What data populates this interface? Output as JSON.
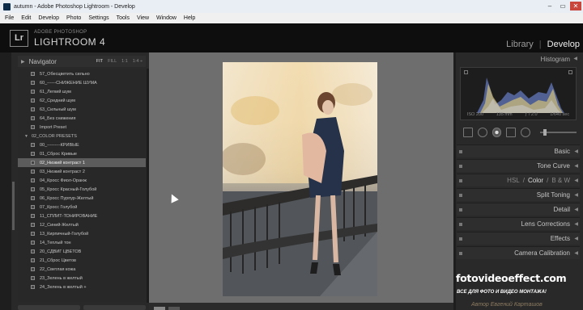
{
  "window": {
    "title": "autumn - Adobe Photoshop Lightroom - Develop",
    "controls": [
      "–",
      "▭",
      "✕"
    ]
  },
  "menu": [
    "File",
    "Edit",
    "Develop",
    "Photo",
    "Settings",
    "Tools",
    "View",
    "Window",
    "Help"
  ],
  "identity": {
    "logo": "Lr",
    "sup": "ADOBE PHOTOSHOP",
    "product": "LIGHTROOM 4",
    "modules": [
      "Library",
      "|",
      "Develop"
    ]
  },
  "navigator": {
    "label": "Navigator",
    "zoom": [
      "FIT",
      "FILL",
      "1:1",
      "1:4 ÷"
    ]
  },
  "presets": [
    {
      "label": "57_Обесцветить сильно",
      "kind": "item"
    },
    {
      "label": "60_------СНИЖЕНИЕ ШУМА",
      "kind": "item"
    },
    {
      "label": "61_Легкий шум",
      "kind": "item"
    },
    {
      "label": "62_Средний шум",
      "kind": "item"
    },
    {
      "label": "63_Сильный шум",
      "kind": "item"
    },
    {
      "label": "64_Без снижения",
      "kind": "item"
    },
    {
      "label": "Import Preset",
      "kind": "item"
    },
    {
      "label": "02_COLOR PRESETS",
      "kind": "folder"
    },
    {
      "label": "00_---------КРИВЫЕ",
      "kind": "item"
    },
    {
      "label": "01_Сброс Кривые",
      "kind": "item"
    },
    {
      "label": "02_Низкий контраст 1",
      "kind": "item",
      "selected": true
    },
    {
      "label": "03_Низкий контраст 2",
      "kind": "item"
    },
    {
      "label": "04_Кросс Фиол-Оранж",
      "kind": "item"
    },
    {
      "label": "05_Кросс Красный-Голубой",
      "kind": "item"
    },
    {
      "label": "06_Кросс Пурпур-Желтый",
      "kind": "item"
    },
    {
      "label": "07_Кросс Голубой",
      "kind": "item"
    },
    {
      "label": "11_СПЛИТ-ТОНИРОВАНИЕ",
      "kind": "item"
    },
    {
      "label": "12_Синий-Желтый",
      "kind": "item"
    },
    {
      "label": "13_Кирпичный-Голубой",
      "kind": "item"
    },
    {
      "label": "14_Теплый тон",
      "kind": "item"
    },
    {
      "label": "20_СДВИГ ЦВЕТОВ",
      "kind": "item"
    },
    {
      "label": "21_Сброс Цветов",
      "kind": "item"
    },
    {
      "label": "22_Светлая кожа",
      "kind": "item"
    },
    {
      "label": "23_Зелень в желтый",
      "kind": "item"
    },
    {
      "label": "24_Зелень в желтый +",
      "kind": "item"
    }
  ],
  "histogram": {
    "label": "Histogram",
    "camera": [
      "ISO 200",
      "135 mm",
      "ƒ / 2.0",
      "1/640 sec"
    ]
  },
  "sections": [
    {
      "label": "Basic"
    },
    {
      "label": "Tone Curve"
    },
    {
      "label": "HSL / Color / B & W",
      "parts": [
        "HSL",
        "/",
        "Color",
        "/",
        "B & W"
      ]
    },
    {
      "label": "Split Toning"
    },
    {
      "label": "Detail"
    },
    {
      "label": "Lens Corrections"
    },
    {
      "label": "Effects"
    },
    {
      "label": "Camera Calibration"
    }
  ],
  "watermark": {
    "site": "fotovideoeffect.com",
    "tagline": "ВСЕ ДЛЯ ФОТО И ВИДЕО МОНТАЖА!",
    "author": "Автор Евгений Карташов"
  },
  "colors": {
    "accent": "#e8e8e8",
    "selected_row": "#5c5c5c",
    "canvas": "#6e6e6e"
  }
}
